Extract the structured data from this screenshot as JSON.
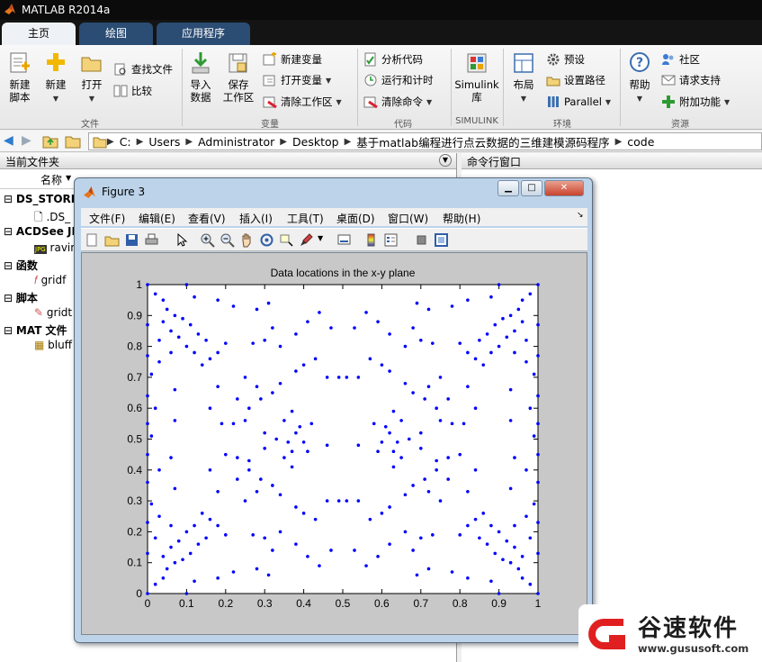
{
  "window": {
    "title": "MATLAB R2014a"
  },
  "tabs": [
    {
      "label": "主页"
    },
    {
      "label": "绘图"
    },
    {
      "label": "应用程序"
    }
  ],
  "ribbon": {
    "new_script": "新建\n脚本",
    "new": "新建",
    "open": "打开",
    "find_files": "查找文件",
    "compare": "比较",
    "group_file": "文件",
    "import_data": "导入\n数据",
    "save_workspace": "保存\n工作区",
    "new_variable": "新建变量",
    "open_variable": "打开变量",
    "clear_workspace": "清除工作区",
    "group_variable": "变量",
    "analyze_code": "分析代码",
    "run_and_time": "运行和计时",
    "clear_commands": "清除命令",
    "group_code": "代码",
    "simulink": "Simulink\n库",
    "group_simulink": "SIMULINK",
    "layout": "布局",
    "preferences": "预设",
    "set_path": "设置路径",
    "parallel": "Parallel",
    "group_env": "环境",
    "help": "帮助",
    "community": "社区",
    "request_support": "请求支持",
    "addons": "附加功能",
    "group_resources": "资源"
  },
  "address": {
    "segments": [
      "C:",
      "Users",
      "Administrator",
      "Desktop",
      "基于matlab编程进行点云数据的三维建模源码程序",
      "code"
    ]
  },
  "current_folder": {
    "title": "当前文件夹",
    "column_name": "名称",
    "items": [
      {
        "group": "DS_STORE",
        "file": ".DS_"
      },
      {
        "group": "ACDSee JP",
        "file": "ravin"
      },
      {
        "group": "函数",
        "file": "gridf"
      },
      {
        "group": "脚本",
        "file": "gridt"
      },
      {
        "group": "MAT 文件",
        "file": "bluff"
      }
    ]
  },
  "command_window": {
    "title": "命令行窗口"
  },
  "figure": {
    "title": "Figure 3",
    "menus": [
      "文件(F)",
      "编辑(E)",
      "查看(V)",
      "插入(I)",
      "工具(T)",
      "桌面(D)",
      "窗口(W)",
      "帮助(H)"
    ]
  },
  "chart_data": {
    "type": "scatter",
    "title": "Data locations in the x-y plane",
    "xlabel": "",
    "ylabel": "",
    "xlim": [
      0,
      1
    ],
    "ylim": [
      0,
      1
    ],
    "xticks": [
      "0",
      "0.1",
      "0.2",
      "0.3",
      "0.4",
      "0.5",
      "0.6",
      "0.7",
      "0.8",
      "0.9",
      "1"
    ],
    "yticks": [
      "0",
      "0.1",
      "0.2",
      "0.3",
      "0.4",
      "0.5",
      "0.6",
      "0.7",
      "0.8",
      "0.9",
      "1"
    ],
    "marker_color": "#0000ff",
    "grid": false,
    "series": [
      {
        "points": [
          [
            0,
            0
          ],
          [
            0.1,
            0
          ],
          [
            0.9,
            0
          ],
          [
            1,
            0
          ],
          [
            0,
            1
          ],
          [
            0.1,
            1
          ],
          [
            0.9,
            1
          ],
          [
            1,
            1
          ],
          [
            0.02,
            0.97
          ],
          [
            0.98,
            0.97
          ],
          [
            0.02,
            0.03
          ],
          [
            0.98,
            0.03
          ],
          [
            0,
            0.13
          ],
          [
            0,
            0.23
          ],
          [
            0,
            0.36
          ],
          [
            0,
            0.45
          ],
          [
            0,
            0.55
          ],
          [
            0,
            0.64
          ],
          [
            0,
            0.77
          ],
          [
            0,
            0.87
          ],
          [
            1,
            0.13
          ],
          [
            1,
            0.23
          ],
          [
            1,
            0.36
          ],
          [
            1,
            0.45
          ],
          [
            1,
            0.55
          ],
          [
            1,
            0.64
          ],
          [
            1,
            0.77
          ],
          [
            1,
            0.87
          ],
          [
            0.01,
            0.29
          ],
          [
            0.01,
            0.71
          ],
          [
            0.99,
            0.29
          ],
          [
            0.99,
            0.71
          ],
          [
            0.02,
            0.18
          ],
          [
            0.03,
            0.4
          ],
          [
            0.02,
            0.6
          ],
          [
            0.03,
            0.82
          ],
          [
            0.98,
            0.18
          ],
          [
            0.97,
            0.4
          ],
          [
            0.98,
            0.6
          ],
          [
            0.97,
            0.82
          ],
          [
            0.01,
            0.51
          ],
          [
            0.99,
            0.51
          ],
          [
            0.05,
            0.08
          ],
          [
            0.07,
            0.1
          ],
          [
            0.09,
            0.11
          ],
          [
            0.06,
            0.15
          ],
          [
            0.08,
            0.17
          ],
          [
            0.1,
            0.2
          ],
          [
            0.12,
            0.22
          ],
          [
            0.05,
            0.92
          ],
          [
            0.07,
            0.9
          ],
          [
            0.09,
            0.89
          ],
          [
            0.06,
            0.85
          ],
          [
            0.08,
            0.83
          ],
          [
            0.1,
            0.8
          ],
          [
            0.12,
            0.78
          ],
          [
            0.95,
            0.08
          ],
          [
            0.93,
            0.1
          ],
          [
            0.91,
            0.11
          ],
          [
            0.94,
            0.15
          ],
          [
            0.92,
            0.17
          ],
          [
            0.9,
            0.2
          ],
          [
            0.88,
            0.22
          ],
          [
            0.95,
            0.92
          ],
          [
            0.93,
            0.9
          ],
          [
            0.91,
            0.89
          ],
          [
            0.94,
            0.85
          ],
          [
            0.92,
            0.83
          ],
          [
            0.9,
            0.8
          ],
          [
            0.88,
            0.78
          ],
          [
            0.04,
            0.12
          ],
          [
            0.06,
            0.22
          ],
          [
            0.03,
            0.25
          ],
          [
            0.04,
            0.88
          ],
          [
            0.06,
            0.78
          ],
          [
            0.03,
            0.75
          ],
          [
            0.96,
            0.12
          ],
          [
            0.94,
            0.22
          ],
          [
            0.97,
            0.25
          ],
          [
            0.96,
            0.88
          ],
          [
            0.94,
            0.78
          ],
          [
            0.97,
            0.75
          ],
          [
            0.11,
            0.13
          ],
          [
            0.13,
            0.16
          ],
          [
            0.15,
            0.18
          ],
          [
            0.16,
            0.24
          ],
          [
            0.14,
            0.26
          ],
          [
            0.18,
            0.22
          ],
          [
            0.2,
            0.19
          ],
          [
            0.11,
            0.87
          ],
          [
            0.13,
            0.84
          ],
          [
            0.15,
            0.82
          ],
          [
            0.16,
            0.76
          ],
          [
            0.14,
            0.74
          ],
          [
            0.18,
            0.78
          ],
          [
            0.2,
            0.81
          ],
          [
            0.89,
            0.13
          ],
          [
            0.87,
            0.16
          ],
          [
            0.85,
            0.18
          ],
          [
            0.84,
            0.24
          ],
          [
            0.86,
            0.26
          ],
          [
            0.82,
            0.22
          ],
          [
            0.8,
            0.19
          ],
          [
            0.89,
            0.87
          ],
          [
            0.87,
            0.84
          ],
          [
            0.85,
            0.82
          ],
          [
            0.84,
            0.76
          ],
          [
            0.86,
            0.74
          ],
          [
            0.82,
            0.78
          ],
          [
            0.8,
            0.81
          ],
          [
            0.12,
            0.04
          ],
          [
            0.18,
            0.05
          ],
          [
            0.22,
            0.07
          ],
          [
            0.28,
            0.08
          ],
          [
            0.12,
            0.96
          ],
          [
            0.18,
            0.95
          ],
          [
            0.22,
            0.93
          ],
          [
            0.28,
            0.92
          ],
          [
            0.88,
            0.04
          ],
          [
            0.82,
            0.05
          ],
          [
            0.78,
            0.07
          ],
          [
            0.72,
            0.08
          ],
          [
            0.88,
            0.96
          ],
          [
            0.82,
            0.95
          ],
          [
            0.78,
            0.93
          ],
          [
            0.72,
            0.92
          ],
          [
            0.31,
            0.06
          ],
          [
            0.69,
            0.06
          ],
          [
            0.31,
            0.94
          ],
          [
            0.69,
            0.94
          ],
          [
            0.27,
            0.19
          ],
          [
            0.3,
            0.18
          ],
          [
            0.34,
            0.2
          ],
          [
            0.38,
            0.16
          ],
          [
            0.32,
            0.14
          ],
          [
            0.27,
            0.81
          ],
          [
            0.3,
            0.82
          ],
          [
            0.34,
            0.8
          ],
          [
            0.38,
            0.84
          ],
          [
            0.32,
            0.86
          ],
          [
            0.73,
            0.19
          ],
          [
            0.7,
            0.18
          ],
          [
            0.66,
            0.2
          ],
          [
            0.62,
            0.16
          ],
          [
            0.68,
            0.14
          ],
          [
            0.73,
            0.81
          ],
          [
            0.7,
            0.82
          ],
          [
            0.66,
            0.8
          ],
          [
            0.62,
            0.84
          ],
          [
            0.68,
            0.86
          ],
          [
            0.41,
            0.12
          ],
          [
            0.44,
            0.09
          ],
          [
            0.47,
            0.14
          ],
          [
            0.41,
            0.88
          ],
          [
            0.44,
            0.91
          ],
          [
            0.47,
            0.86
          ],
          [
            0.59,
            0.12
          ],
          [
            0.56,
            0.09
          ],
          [
            0.53,
            0.14
          ],
          [
            0.59,
            0.88
          ],
          [
            0.56,
            0.91
          ],
          [
            0.53,
            0.86
          ],
          [
            0.46,
            0.3
          ],
          [
            0.49,
            0.3
          ],
          [
            0.51,
            0.3
          ],
          [
            0.54,
            0.3
          ],
          [
            0.46,
            0.7
          ],
          [
            0.49,
            0.7
          ],
          [
            0.51,
            0.7
          ],
          [
            0.54,
            0.7
          ],
          [
            0.43,
            0.24
          ],
          [
            0.57,
            0.24
          ],
          [
            0.43,
            0.76
          ],
          [
            0.57,
            0.76
          ],
          [
            0.38,
            0.28
          ],
          [
            0.4,
            0.26
          ],
          [
            0.62,
            0.28
          ],
          [
            0.6,
            0.26
          ],
          [
            0.38,
            0.72
          ],
          [
            0.4,
            0.74
          ],
          [
            0.62,
            0.72
          ],
          [
            0.6,
            0.74
          ],
          [
            0.23,
            0.37
          ],
          [
            0.26,
            0.4
          ],
          [
            0.29,
            0.37
          ],
          [
            0.32,
            0.35
          ],
          [
            0.34,
            0.32
          ],
          [
            0.25,
            0.3
          ],
          [
            0.28,
            0.33
          ],
          [
            0.23,
            0.63
          ],
          [
            0.26,
            0.6
          ],
          [
            0.29,
            0.63
          ],
          [
            0.32,
            0.65
          ],
          [
            0.34,
            0.68
          ],
          [
            0.25,
            0.7
          ],
          [
            0.28,
            0.67
          ],
          [
            0.77,
            0.37
          ],
          [
            0.74,
            0.4
          ],
          [
            0.71,
            0.37
          ],
          [
            0.68,
            0.35
          ],
          [
            0.66,
            0.32
          ],
          [
            0.75,
            0.3
          ],
          [
            0.72,
            0.33
          ],
          [
            0.77,
            0.63
          ],
          [
            0.74,
            0.6
          ],
          [
            0.71,
            0.63
          ],
          [
            0.68,
            0.65
          ],
          [
            0.66,
            0.68
          ],
          [
            0.75,
            0.7
          ],
          [
            0.72,
            0.67
          ],
          [
            0.2,
            0.45
          ],
          [
            0.23,
            0.44
          ],
          [
            0.26,
            0.43
          ],
          [
            0.19,
            0.55
          ],
          [
            0.22,
            0.55
          ],
          [
            0.25,
            0.56
          ],
          [
            0.8,
            0.45
          ],
          [
            0.77,
            0.44
          ],
          [
            0.74,
            0.43
          ],
          [
            0.81,
            0.55
          ],
          [
            0.78,
            0.55
          ],
          [
            0.75,
            0.56
          ],
          [
            0.16,
            0.4
          ],
          [
            0.16,
            0.6
          ],
          [
            0.84,
            0.4
          ],
          [
            0.84,
            0.6
          ],
          [
            0.18,
            0.33
          ],
          [
            0.18,
            0.67
          ],
          [
            0.82,
            0.33
          ],
          [
            0.82,
            0.67
          ],
          [
            0.36,
            0.49
          ],
          [
            0.38,
            0.52
          ],
          [
            0.4,
            0.49
          ],
          [
            0.37,
            0.46
          ],
          [
            0.39,
            0.54
          ],
          [
            0.41,
            0.46
          ],
          [
            0.64,
            0.49
          ],
          [
            0.62,
            0.52
          ],
          [
            0.6,
            0.49
          ],
          [
            0.63,
            0.46
          ],
          [
            0.61,
            0.54
          ],
          [
            0.59,
            0.46
          ],
          [
            0.33,
            0.5
          ],
          [
            0.35,
            0.44
          ],
          [
            0.35,
            0.56
          ],
          [
            0.67,
            0.5
          ],
          [
            0.65,
            0.44
          ],
          [
            0.65,
            0.56
          ],
          [
            0.37,
            0.41
          ],
          [
            0.63,
            0.41
          ],
          [
            0.37,
            0.59
          ],
          [
            0.63,
            0.59
          ],
          [
            0.46,
            0.48
          ],
          [
            0.54,
            0.48
          ],
          [
            0.42,
            0.55
          ],
          [
            0.58,
            0.55
          ],
          [
            0.07,
            0.34
          ],
          [
            0.06,
            0.44
          ],
          [
            0.07,
            0.56
          ],
          [
            0.07,
            0.66
          ],
          [
            0.93,
            0.34
          ],
          [
            0.94,
            0.44
          ],
          [
            0.93,
            0.56
          ],
          [
            0.93,
            0.66
          ],
          [
            0.04,
            0.95
          ],
          [
            0.96,
            0.95
          ],
          [
            0.04,
            0.05
          ],
          [
            0.96,
            0.05
          ],
          [
            0.3,
            0.52
          ],
          [
            0.7,
            0.52
          ],
          [
            0.3,
            0.47
          ],
          [
            0.7,
            0.47
          ]
        ]
      }
    ]
  }
}
